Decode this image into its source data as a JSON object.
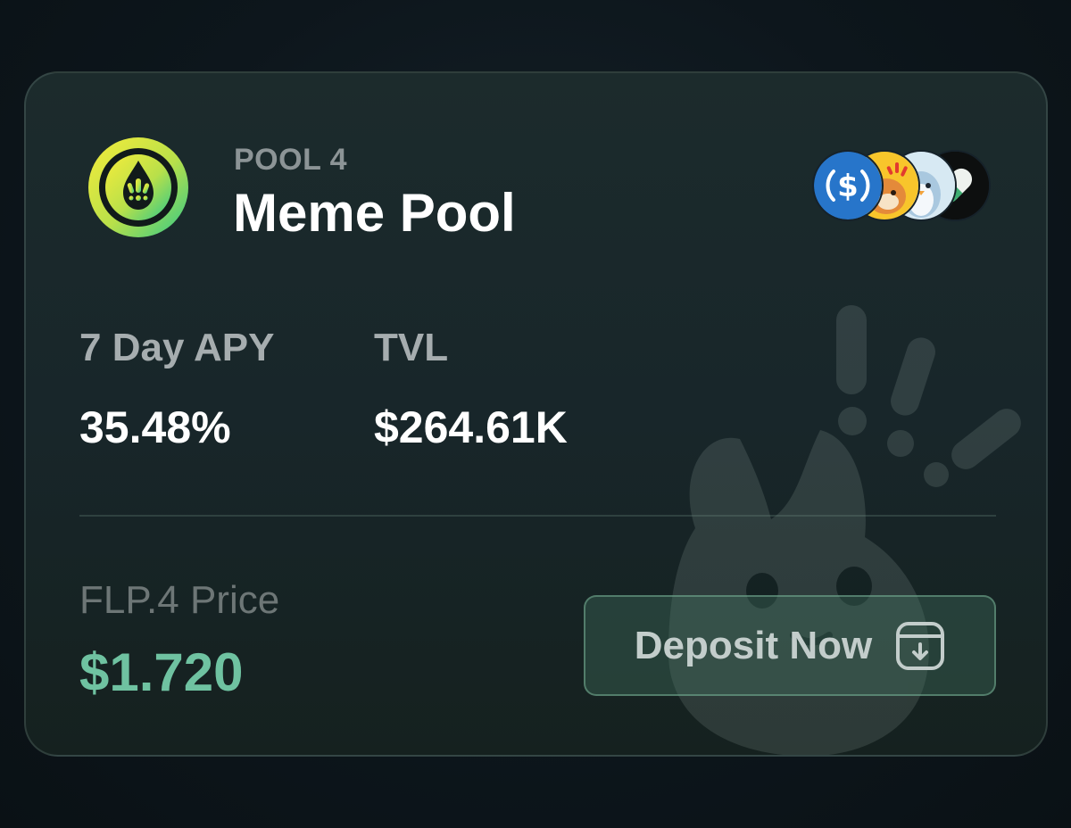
{
  "pool": {
    "number_label": "POOL 4",
    "name": "Meme Pool",
    "logo_icon": "droplet-paw-icon",
    "tokens": [
      "usdc-icon",
      "bonk-icon",
      "penguin-icon",
      "pill-icon"
    ]
  },
  "stats": {
    "apy_label": "7 Day APY",
    "apy_value": "35.48%",
    "tvl_label": "TVL",
    "tvl_value": "$264.61K"
  },
  "price": {
    "label": "FLP.4 Price",
    "value": "$1.720"
  },
  "actions": {
    "deposit_label": "Deposit Now",
    "deposit_icon": "deposit-icon"
  },
  "colors": {
    "accent_green": "#6fc2a1",
    "logo_yellow": "#f2e83a",
    "logo_green": "#36c987",
    "usdc_blue": "#2775ca"
  }
}
